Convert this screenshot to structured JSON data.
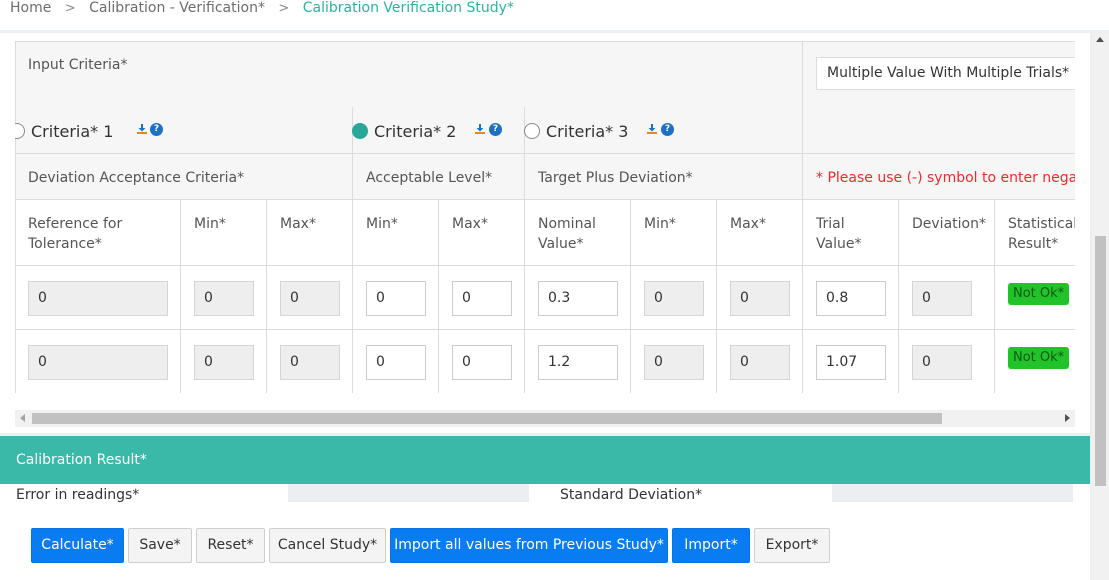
{
  "breadcrumb": {
    "items": [
      "Home",
      "Calibration - Verification*"
    ],
    "current": "Calibration Verification Study*"
  },
  "criteria": {
    "input_label": "Input Criteria*",
    "selected_value": "Multiple Value With Multiple Trials*",
    "options": [
      {
        "label": "Criteria* 1",
        "checked": false
      },
      {
        "label": "Criteria* 2",
        "checked": true
      },
      {
        "label": "Criteria* 3",
        "checked": false
      }
    ]
  },
  "group_headers": {
    "deviation_acceptance": "Deviation Acceptance Criteria*",
    "acceptable_level": "Acceptable Level*",
    "target_plus_deviation": "Target Plus Deviation*",
    "warning": "* Please use (-) symbol to enter negative"
  },
  "columns": [
    "Reference for Tolerance*",
    "Min*",
    "Max*",
    "Min*",
    "Max*",
    "Nominal Value*",
    "Min*",
    "Max*",
    "Trial Value*",
    "Deviation*",
    "Statistical Result*"
  ],
  "rows": [
    {
      "reference": "0",
      "dev_min": "0",
      "dev_max": "0",
      "acc_min": "0",
      "acc_max": "0",
      "nominal": "0.3",
      "tgt_min": "0",
      "tgt_max": "0",
      "trial": "0.8",
      "deviation": "0",
      "result": "Not Ok*"
    },
    {
      "reference": "0",
      "dev_min": "0",
      "dev_max": "0",
      "acc_min": "0",
      "acc_max": "0",
      "nominal": "1.2",
      "tgt_min": "0",
      "tgt_max": "0",
      "trial": "1.07",
      "deviation": "0",
      "result": "Not Ok*"
    }
  ],
  "calibration_result": {
    "title": "Calibration Result*",
    "error_label": "Error in readings*",
    "std_dev_label": "Standard Deviation*"
  },
  "actions": {
    "calculate": "Calculate*",
    "save": "Save*",
    "reset": "Reset*",
    "cancel": "Cancel Study*",
    "import_all": "Import all values from Previous Study*",
    "import": "Import*",
    "export": "Export*"
  },
  "colors": {
    "accent": "#3ab8a8",
    "primary": "#0a7cf2",
    "badge_fail": "#22c22a",
    "warning": "#ee2b2b"
  }
}
